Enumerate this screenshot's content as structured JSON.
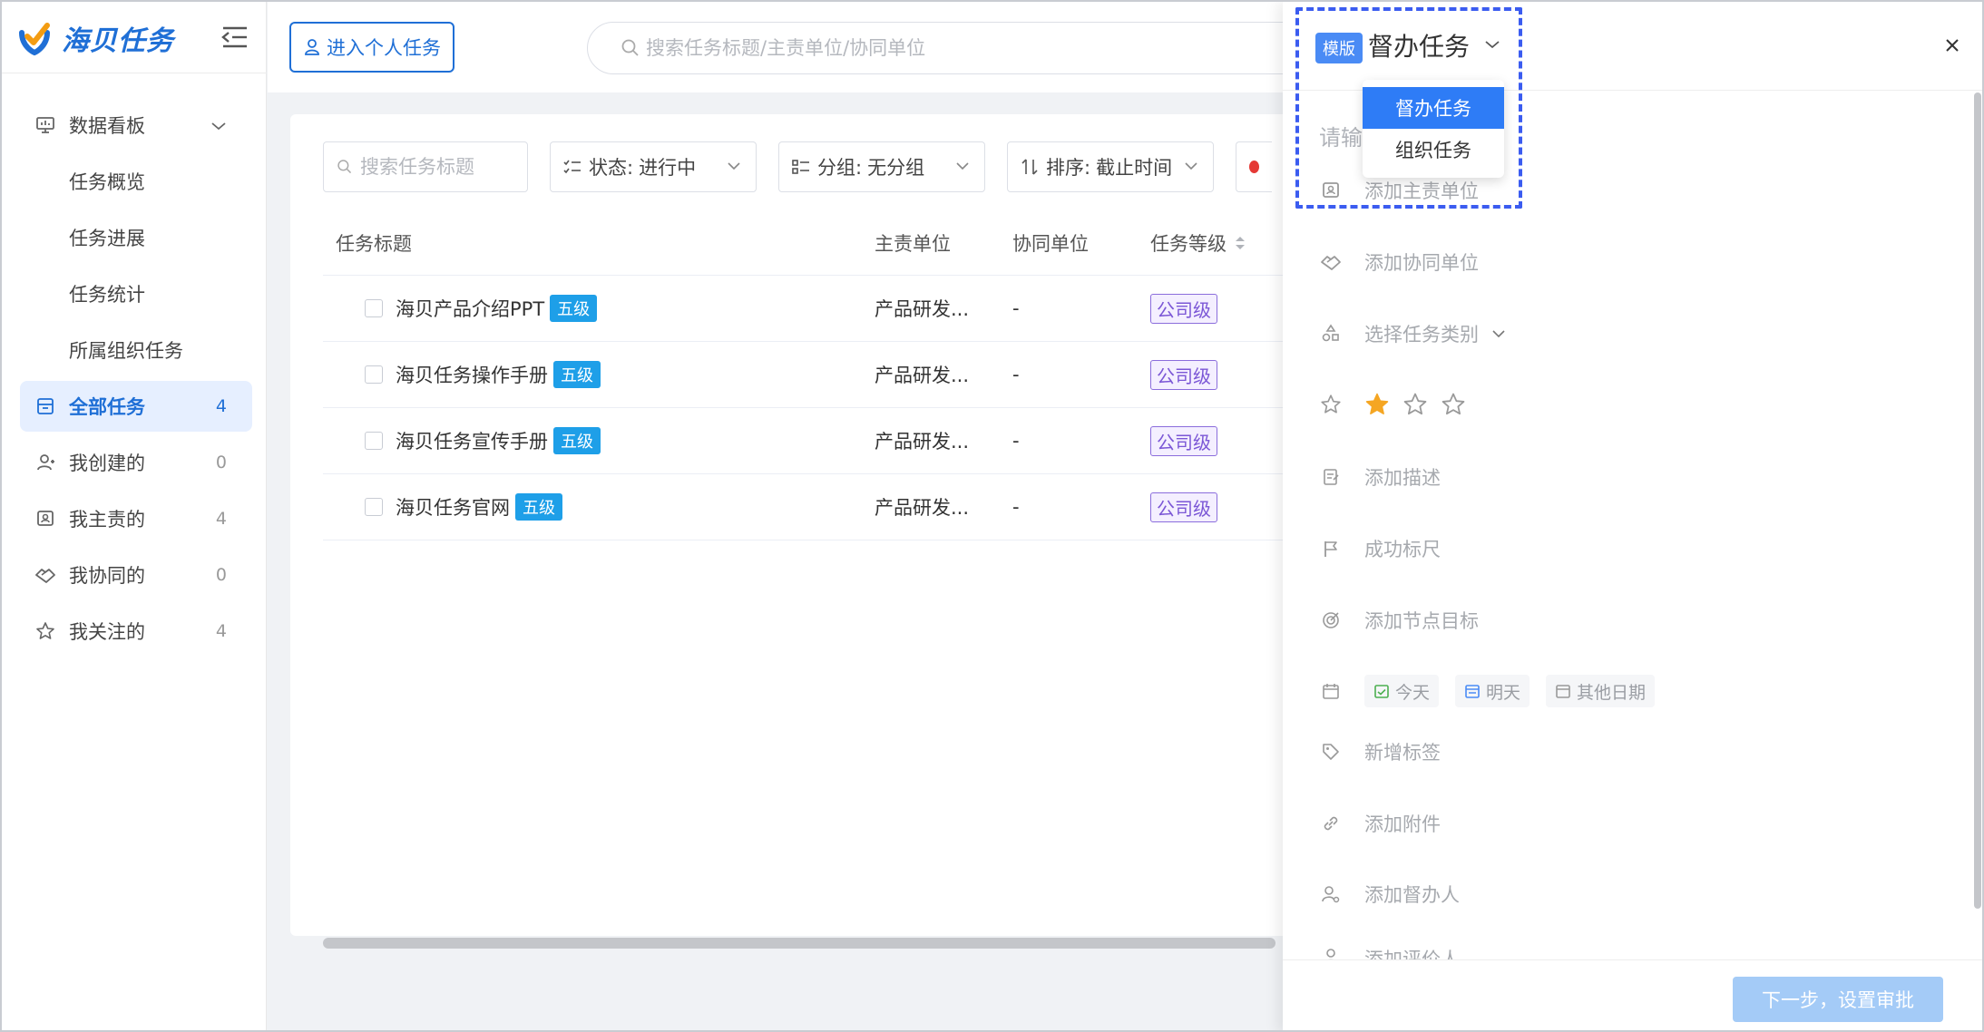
{
  "brand": {
    "name": "海贝任务"
  },
  "sidebar": {
    "items": [
      {
        "label": "数据看板",
        "icon": "monitor-icon",
        "expanded": true
      },
      {
        "label": "任务概览",
        "sub": true
      },
      {
        "label": "任务进展",
        "sub": true
      },
      {
        "label": "任务统计",
        "sub": true
      },
      {
        "label": "所属组织任务",
        "sub": true
      },
      {
        "label": "全部任务",
        "icon": "inbox-icon",
        "count": "4",
        "active": true
      },
      {
        "label": "我创建的",
        "icon": "user-add-icon",
        "count": "0"
      },
      {
        "label": "我主责的",
        "icon": "id-card-icon",
        "count": "4"
      },
      {
        "label": "我协同的",
        "icon": "handshake-icon",
        "count": "0"
      },
      {
        "label": "我关注的",
        "icon": "star-icon",
        "count": "4"
      }
    ]
  },
  "topbar": {
    "personal_task_label": "进入个人任务",
    "search_placeholder": "搜索任务标题/主责单位/协同单位"
  },
  "filters": {
    "search_placeholder": "搜索任务标题",
    "status_label": "状态:",
    "status_value": "进行中",
    "group_label": "分组:",
    "group_value": "无分组",
    "sort_label": "排序:",
    "sort_value": "截止时间"
  },
  "table": {
    "headers": [
      "任务标题",
      "主责单位",
      "协同单位",
      "任务等级"
    ],
    "rows": [
      {
        "title": "海贝产品介绍PPT",
        "level_tag": "五级",
        "main_unit": "产品研发...",
        "assist_unit": "-",
        "grade": "公司级"
      },
      {
        "title": "海贝任务操作手册",
        "level_tag": "五级",
        "main_unit": "产品研发...",
        "assist_unit": "-",
        "grade": "公司级"
      },
      {
        "title": "海贝任务宣传手册",
        "level_tag": "五级",
        "main_unit": "产品研发...",
        "assist_unit": "-",
        "grade": "公司级"
      },
      {
        "title": "海贝任务官网",
        "level_tag": "五级",
        "main_unit": "产品研发...",
        "assist_unit": "-",
        "grade": "公司级"
      }
    ]
  },
  "drawer": {
    "template_badge": "模版",
    "template_title": "督办任务",
    "dropdown_options": [
      "督办任务",
      "组织任务"
    ],
    "name_placeholder": "请输",
    "fields": {
      "main_unit": "添加主责单位",
      "assist_unit": "添加协同单位",
      "category": "选择任务类别",
      "description": "添加描述",
      "success_ruler": "成功标尺",
      "milestone": "添加节点目标",
      "tag": "新增标签",
      "attachment": "添加附件",
      "supervisor": "添加督办人",
      "evaluator": "添加评价人"
    },
    "stars": {
      "rating": 1,
      "max": 3
    },
    "dates": [
      "今天",
      "明天",
      "其他日期"
    ],
    "next_button": "下一步，设置审批"
  },
  "colors": {
    "primary": "#1f6fd6",
    "level_tag": "#1e9fe8",
    "grade_tag": "#7b57d6",
    "focus_dash": "#3b5cf0",
    "star": "#f5a623"
  }
}
